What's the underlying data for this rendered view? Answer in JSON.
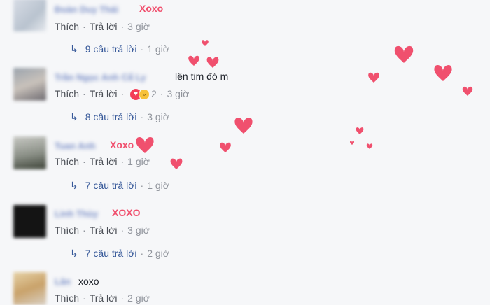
{
  "comments": [
    {
      "name": "Đoàn Duy Thái",
      "text": "Xoxo",
      "like": "Thích",
      "reply": "Trả lời",
      "time": "3 giờ",
      "reactions": "",
      "replies": {
        "label": "9 câu trả lời",
        "time": "1 giờ"
      }
    },
    {
      "name": "Trần Ngọc Anh Cẩ Ly",
      "text": "lên tim đó m",
      "like": "Thích",
      "reply": "Trả lời",
      "time": "3 giờ",
      "reactions": "2",
      "replies": {
        "label": "8 câu trả lời",
        "time": "3 giờ"
      }
    },
    {
      "name": "Tuan Anh",
      "text": "Xoxo",
      "like": "Thích",
      "reply": "Trả lời",
      "time": "1 giờ",
      "reactions": "",
      "replies": {
        "label": "7 câu trả lời",
        "time": "1 giờ"
      }
    },
    {
      "name": "Linh Thùy",
      "text": "XOXO",
      "like": "Thích",
      "reply": "Trả lời",
      "time": "3 giờ",
      "reactions": "",
      "replies": {
        "label": "7 câu trả lời",
        "time": "2 giờ"
      }
    },
    {
      "name": "Lân",
      "text": "xoxo",
      "like": "Thích",
      "reply": "Trả lời",
      "time": "2 giờ",
      "reactions": ""
    }
  ],
  "separator": "·",
  "icons": {
    "reply_arrow": "reply-arrow-icon",
    "love": "love-reaction-icon",
    "haha": "haha-reaction-icon",
    "heart": "floating-heart-icon"
  },
  "colors": {
    "name": "#7b8fc7",
    "highlight_text": "#f0506e",
    "link": "#365899",
    "meta": "#90949c",
    "heart": "#f0506e"
  }
}
